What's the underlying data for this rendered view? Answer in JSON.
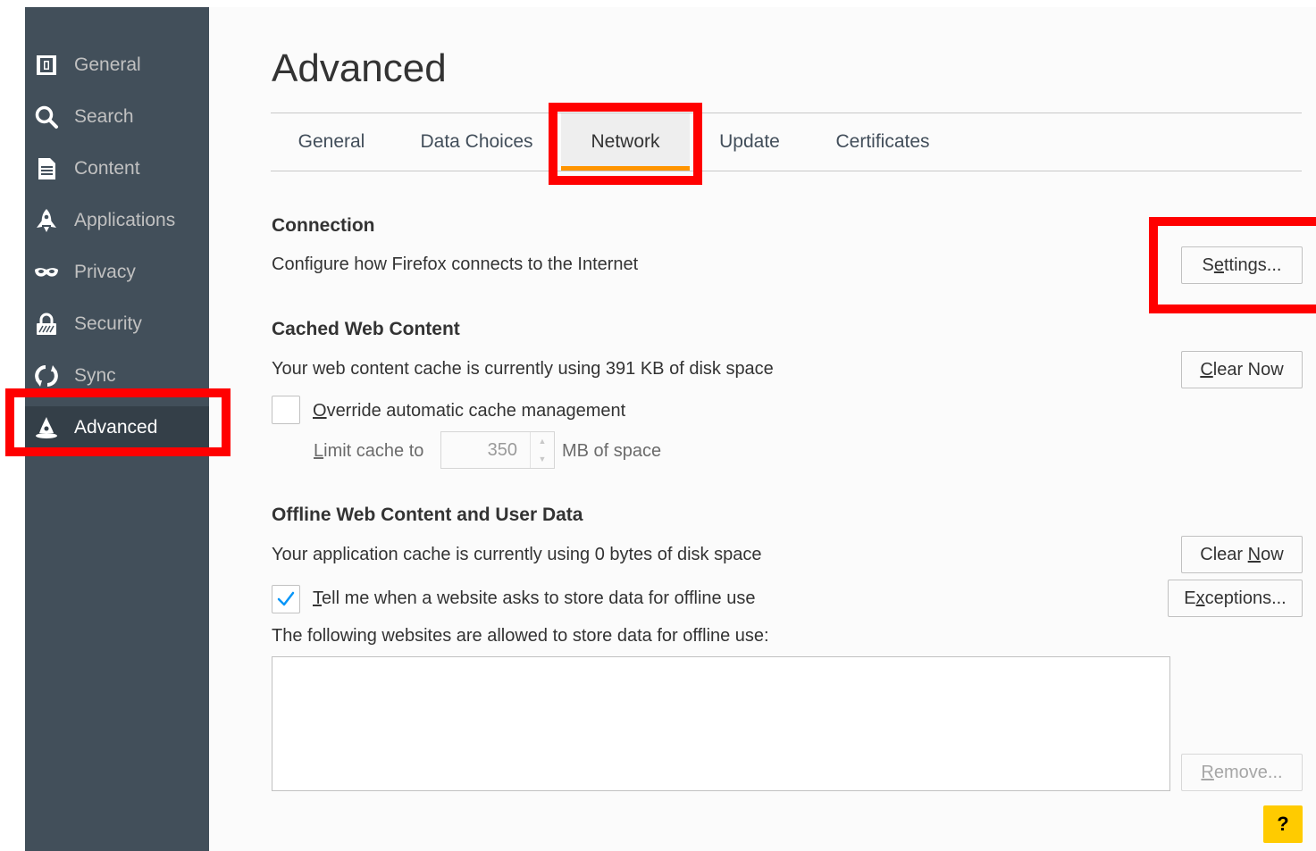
{
  "sidebar": {
    "items": [
      {
        "label": "General",
        "icon": "general-icon",
        "selected": false
      },
      {
        "label": "Search",
        "icon": "search-icon",
        "selected": false
      },
      {
        "label": "Content",
        "icon": "document-icon",
        "selected": false
      },
      {
        "label": "Applications",
        "icon": "rocket-icon",
        "selected": false
      },
      {
        "label": "Privacy",
        "icon": "mask-icon",
        "selected": false
      },
      {
        "label": "Security",
        "icon": "lock-icon",
        "selected": false
      },
      {
        "label": "Sync",
        "icon": "sync-icon",
        "selected": false
      },
      {
        "label": "Advanced",
        "icon": "wizard-hat-icon",
        "selected": true
      }
    ]
  },
  "page": {
    "title": "Advanced"
  },
  "tabs": [
    {
      "label": "General",
      "selected": false
    },
    {
      "label": "Data Choices",
      "selected": false
    },
    {
      "label": "Network",
      "selected": true
    },
    {
      "label": "Update",
      "selected": false
    },
    {
      "label": "Certificates",
      "selected": false
    }
  ],
  "connection": {
    "title": "Connection",
    "description": "Configure how Firefox connects to the Internet",
    "settings_button": {
      "label": "Settings...",
      "access_key": "t"
    }
  },
  "cached": {
    "title": "Cached Web Content",
    "description": "Your web content cache is currently using 391 KB of disk space",
    "clear_button": {
      "label": "Clear Now",
      "access_key": "C"
    },
    "override": {
      "label": "Override automatic cache management",
      "access_key": "O",
      "checked": false
    },
    "limit": {
      "prefix": "Limit cache to",
      "access_key": "L",
      "value": "350",
      "suffix": "MB of space"
    }
  },
  "offline": {
    "title": "Offline Web Content and User Data",
    "description": "Your application cache is currently using 0 bytes of disk space",
    "clear_button": {
      "label": "Clear Now",
      "access_key": "N"
    },
    "tell_me": {
      "label": "Tell me when a website asks to store data for offline use",
      "access_key": "T",
      "checked": true
    },
    "exceptions_button": {
      "label": "Exceptions...",
      "access_key": "x"
    },
    "list_label": "The following websites are allowed to store data for offline use:",
    "remove_button": {
      "label": "Remove...",
      "access_key": "R",
      "disabled": true
    }
  },
  "help": {
    "label": "?"
  },
  "colors": {
    "sidebar_bg": "#424f5a",
    "sidebar_selected_bg": "#343f48",
    "tab_accent": "#ff9500",
    "highlight": "#ff0000",
    "help_bg": "#ffcb00",
    "check": "#0996f8"
  }
}
